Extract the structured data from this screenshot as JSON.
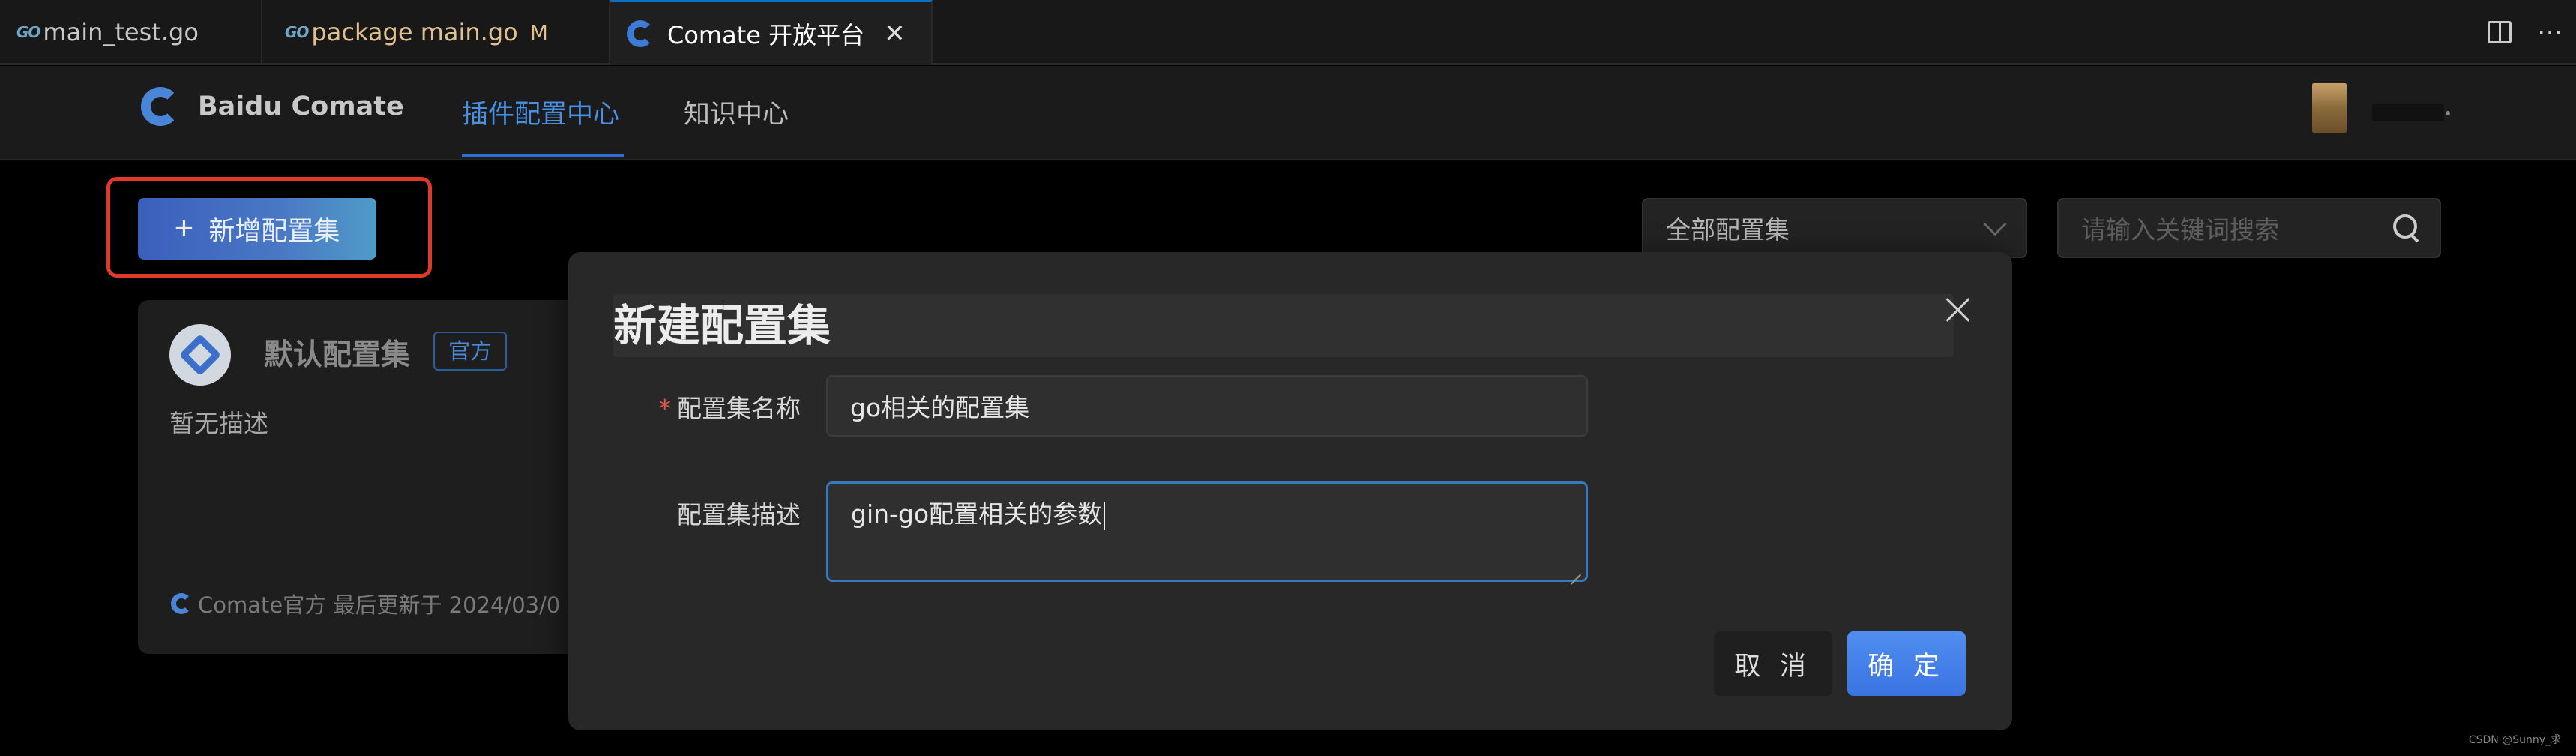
{
  "editor_tabs": [
    {
      "label": "main_test.go",
      "icon": "go-icon",
      "modified": ""
    },
    {
      "label": "package main.go",
      "icon": "go-icon",
      "modified": "M"
    },
    {
      "label": "Comate 开放平台",
      "icon": "comate-icon",
      "modified": ""
    }
  ],
  "go_icon_text": "GO",
  "header": {
    "brand": "Baidu Comate",
    "nav": [
      "插件配置中心",
      "知识中心"
    ]
  },
  "toolbar": {
    "add_button": "新增配置集",
    "filter_value": "全部配置集",
    "search_placeholder": "请输入关键词搜索"
  },
  "card": {
    "title": "默认配置集",
    "badge": "官方",
    "description": "暂无描述",
    "footer": "Comate官方 最后更新于 2024/03/0"
  },
  "modal": {
    "title": "新建配置集",
    "name_label": "配置集名称",
    "required_mark": "*",
    "name_value": "go相关的配置集",
    "desc_label": "配置集描述",
    "desc_value": "gin-go配置相关的参数",
    "cancel_label": "取 消",
    "ok_label": "确 定"
  },
  "watermark": "CSDN @Sunny_求",
  "colors": {
    "accent": "#3a74e2",
    "highlight_border": "#e0392b",
    "link_active": "#4a8fe0",
    "modified": "#e2c08d"
  }
}
